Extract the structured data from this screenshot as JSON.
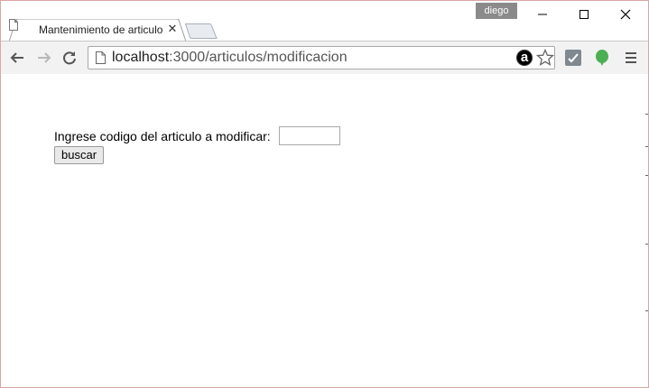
{
  "browser": {
    "tab_title": "Mantenimiento de articulo",
    "profile_name": "diego",
    "url_host": "localhost",
    "url_path": ":3000/articulos/modificacion"
  },
  "icons": {
    "back": "back-arrow-icon",
    "forward": "forward-arrow-icon",
    "reload": "reload-icon",
    "page": "page-icon",
    "amazon": "amazon-extension-icon",
    "bookmark": "star-icon",
    "ext1": "checkmark-extension-icon",
    "ext2": "green-bubble-extension-icon",
    "menu": "hamburger-menu-icon"
  },
  "amazon_ext_letter": "a",
  "form": {
    "label": "Ingrese codigo del articulo a modificar:",
    "input_value": "",
    "button_label": "buscar"
  }
}
